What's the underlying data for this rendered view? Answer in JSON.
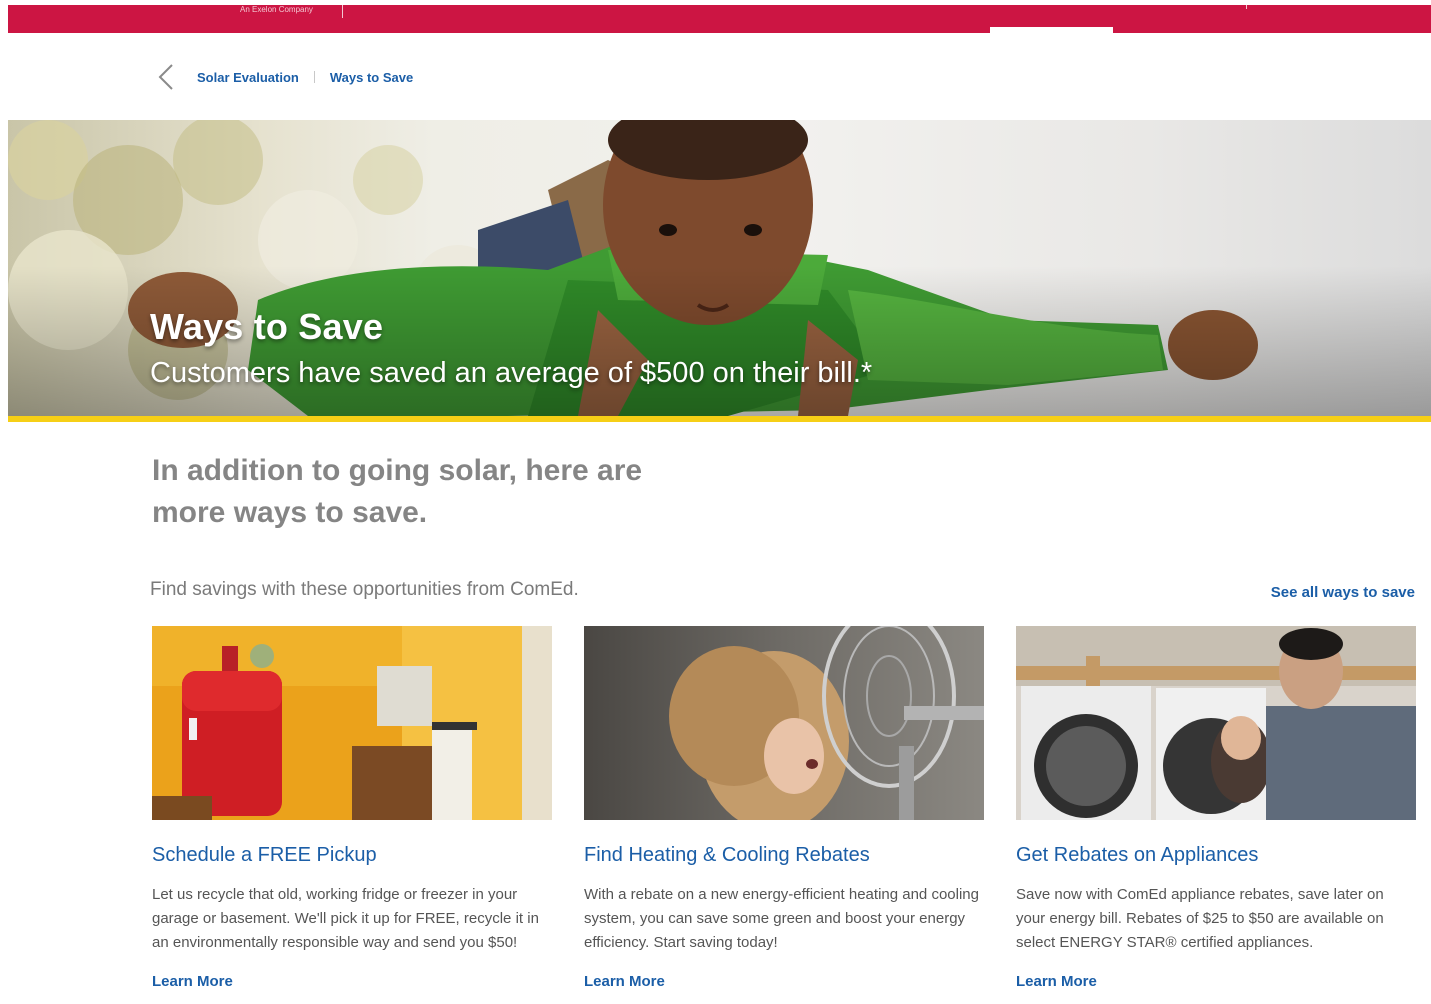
{
  "header": {
    "tagline": "An Exelon Company",
    "brand_color": "#cc1543"
  },
  "breadcrumb": {
    "back_icon": "chevron-left-icon",
    "items": [
      {
        "label": "Solar Evaluation"
      },
      {
        "label": "Ways to Save"
      }
    ]
  },
  "hero": {
    "title": "Ways to Save",
    "subtitle": "Customers have saved an average of $500 on their bill.*",
    "accent_color": "#f6cf16"
  },
  "intro": {
    "heading": "In addition to going solar, here are more ways to save."
  },
  "opportunities": {
    "subhead": "Find savings with these opportunities from ComEd.",
    "see_all_label": "See all ways to save",
    "cards": [
      {
        "title": "Schedule a FREE Pickup",
        "text": "Let us recycle that old, working fridge or freezer in your garage or basement. We'll pick it up for FREE, recycle it in an environmentally responsible way and send you $50!",
        "link": "Learn More"
      },
      {
        "title": "Find Heating & Cooling Rebates",
        "text": "With a rebate on a new energy-efficient heating and cooling system, you can save some green and boost your energy efficiency. Start saving today!",
        "link": "Learn More"
      },
      {
        "title": "Get Rebates on Appliances",
        "text": "Save now with ComEd appliance rebates, save later on your energy bill. Rebates of $25 to $50 are available on select ENERGY STAR® certified appliances.",
        "link": "Learn More"
      }
    ]
  },
  "colors": {
    "link_blue": "#1b5ea7"
  }
}
